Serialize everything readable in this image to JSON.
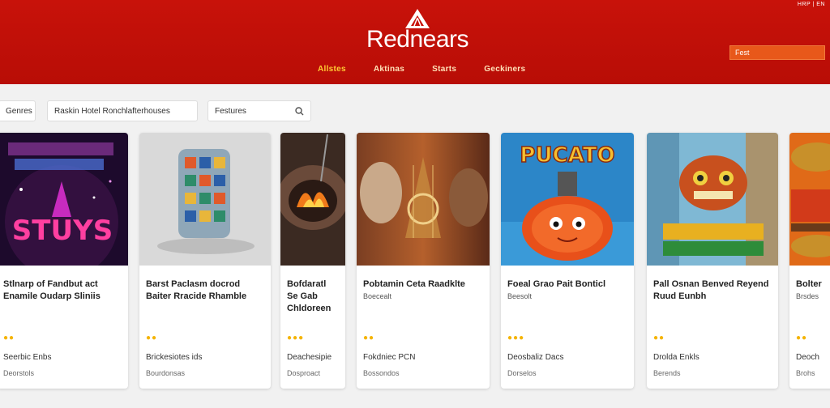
{
  "header": {
    "top_links": "HRP | EN",
    "logo_text": "Rednears",
    "nav": [
      "Allstes",
      "Aktinas",
      "Starts",
      "Geckiners"
    ],
    "search_placeholder": "Fest"
  },
  "filters": {
    "chip1": "Genres",
    "chip2": "Raskin Hotel Ronchlafterhouses",
    "search_placeholder": "Festures"
  },
  "cards": [
    {
      "title": "Stlnarp of Fandbut act Enamile Oudarp Sliniis",
      "sub": "",
      "stars": "●●",
      "meta": "Seerbic Enbs",
      "meta2": "Deorstols"
    },
    {
      "title": "Barst Paclasm docrod Baiter Rracide Rhamble",
      "sub": "",
      "stars": "●●",
      "meta": "Brickesiotes ids",
      "meta2": "Bourdonsas"
    },
    {
      "title": "Bofdaratl Se Gab Chldoreen",
      "sub": "",
      "stars": "●●●",
      "meta": "Deachesipie",
      "meta2": "Dosproact"
    },
    {
      "title": "Pobtamin Ceta Raadklte",
      "sub": "Boecealt",
      "stars": "●●",
      "meta": "Fokdniec PCN",
      "meta2": "Bossondos"
    },
    {
      "title": "Foeal Grao Pait Bonticl",
      "sub": "Beesolt",
      "stars": "●●●",
      "meta": "Deosbaliz Dacs",
      "meta2": "Dorselos"
    },
    {
      "title": "Pall Osnan Benved Reyend Ruud Eunbh",
      "sub": "",
      "stars": "●●",
      "meta": "Drolda Enkls",
      "meta2": "Berends"
    },
    {
      "title": "Bolter",
      "sub": "Brsdes",
      "stars": "●●",
      "meta": "Deoch",
      "meta2": "Brohs"
    }
  ],
  "colors": {
    "header_red": "#c8120a",
    "accent_yellow": "#ffcc33",
    "star": "#f5b400"
  }
}
